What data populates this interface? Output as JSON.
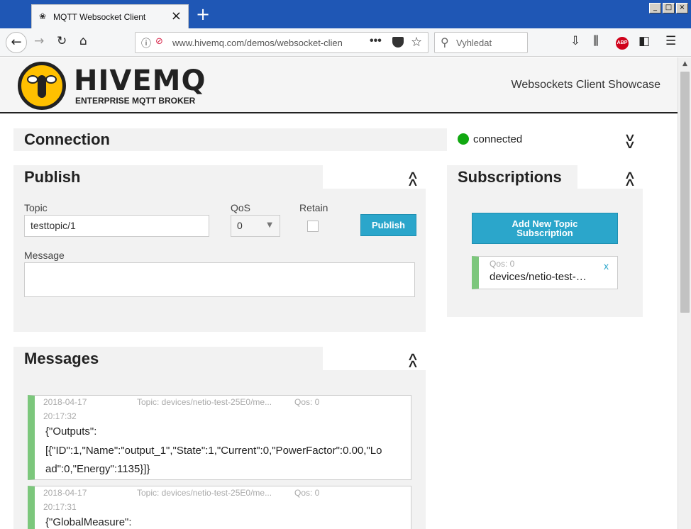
{
  "browser": {
    "tab_title": "MQTT Websocket Client",
    "url": "www.hivemq.com/demos/websocket-clien",
    "search_placeholder": "Vyhledat",
    "abp_label": "ABP"
  },
  "header": {
    "logo_word": "HIVEMQ",
    "logo_sub": "ENTERPRISE MQTT BROKER",
    "showcase": "Websockets Client Showcase"
  },
  "connection": {
    "title": "Connection",
    "status": "connected",
    "status_color": "#11a811"
  },
  "publish": {
    "title": "Publish",
    "topic_label": "Topic",
    "topic_value": "testtopic/1",
    "qos_label": "QoS",
    "qos_value": "0",
    "retain_label": "Retain",
    "button": "Publish",
    "message_label": "Message",
    "message_value": ""
  },
  "subscriptions": {
    "title": "Subscriptions",
    "add_button_line1": "Add New Topic",
    "add_button_line2": "Subscription",
    "items": [
      {
        "qos": "Qos: 0",
        "topic": "devices/netio-test-…",
        "close": "x",
        "color": "#7cc77c"
      }
    ]
  },
  "messages": {
    "title": "Messages",
    "items": [
      {
        "date": "2018-04-17",
        "time": "20:17:32",
        "topic": "Topic: devices/netio-test-25E0/me...",
        "qos": "Qos: 0",
        "lines": [
          "{\"Outputs\":",
          "[{\"ID\":1,\"Name\":\"output_1\",\"State\":1,\"Current\":0,\"PowerFactor\":0.00,\"Lo",
          "ad\":0,\"Energy\":1135}]}"
        ]
      },
      {
        "date": "2018-04-17",
        "time": "20:17:31",
        "topic": "Topic: devices/netio-test-25E0/me...",
        "qos": "Qos: 0",
        "lines": [
          "{\"GlobalMeasure\":"
        ]
      }
    ]
  }
}
